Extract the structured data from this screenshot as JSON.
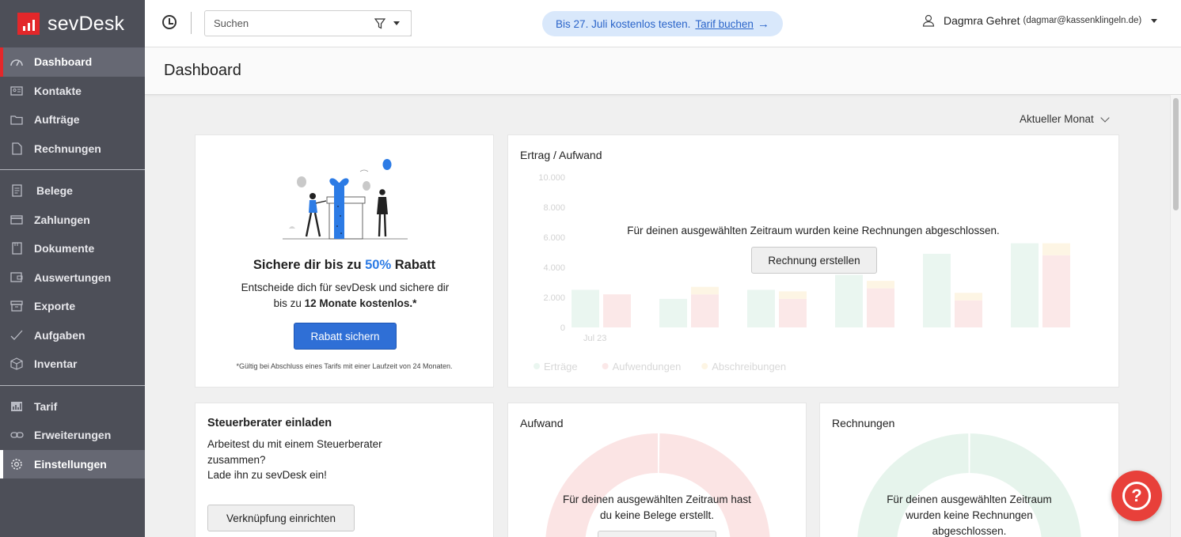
{
  "app": {
    "brand": "sevDesk"
  },
  "sidebar": {
    "items": [
      {
        "label": "Dashboard",
        "icon": "dashboard-icon"
      },
      {
        "label": "Kontakte",
        "icon": "contacts-icon"
      },
      {
        "label": "Aufträge",
        "icon": "folder-icon"
      },
      {
        "label": "Rechnungen",
        "icon": "document-icon"
      },
      {
        "label": "Belege",
        "icon": "receipt-icon"
      },
      {
        "label": "Zahlungen",
        "icon": "card-icon"
      },
      {
        "label": "Dokumente",
        "icon": "file-icon"
      },
      {
        "label": "Auswertungen",
        "icon": "wallet-icon"
      },
      {
        "label": "Exporte",
        "icon": "export-icon"
      },
      {
        "label": "Aufgaben",
        "icon": "check-icon"
      },
      {
        "label": "Inventar",
        "icon": "box-icon"
      },
      {
        "label": "Tarif",
        "icon": "bar-chart-icon"
      },
      {
        "label": "Erweiterungen",
        "icon": "link-icon"
      },
      {
        "label": "Einstellungen",
        "icon": "gear-icon"
      }
    ]
  },
  "topbar": {
    "search_placeholder": "Suchen",
    "trial_text": "Bis 27. Juli kostenlos testen.",
    "trial_link": "Tarif buchen",
    "user_name": "Dagmra Gehret",
    "user_email": "(dagmar@kassenklingeln.de)"
  },
  "header": {
    "title": "Dashboard"
  },
  "period": {
    "label": "Aktueller Monat"
  },
  "promo": {
    "title_prefix": "Sichere dir bis zu ",
    "title_accent": "50%",
    "title_suffix": " Rabatt",
    "text_line1": "Entscheide dich für sevDesk und sichere dir",
    "text_line2_prefix": "bis zu ",
    "text_line2_bold": "12 Monate kostenlos.*",
    "button": "Rabatt sichern",
    "footnote": "*Gültig bei Abschluss eines Tarifs mit einer Laufzeit von 24 Monaten."
  },
  "chart_card": {
    "title": "Ertrag / Aufwand",
    "empty_text": "Für deinen ausgewählten Zeitraum wurden keine Rechnungen abgeschlossen.",
    "button": "Rechnung erstellen"
  },
  "chart_data": {
    "type": "bar",
    "categories": [
      "Jul 23",
      "",
      "",
      "",
      "",
      ""
    ],
    "y_ticks": [
      "10.000",
      "8.000",
      "6.000",
      "4.000",
      "2.000",
      "0"
    ],
    "ylim": [
      0,
      10000
    ],
    "series": [
      {
        "name": "Erträge",
        "values": [
          2500,
          1900,
          2500,
          3500,
          4900,
          5600
        ]
      },
      {
        "name": "Aufwendungen",
        "values": [
          2200,
          2200,
          1900,
          2600,
          1800,
          4800
        ]
      },
      {
        "name": "Abschreibungen",
        "values": [
          0,
          500,
          500,
          500,
          500,
          800
        ]
      }
    ],
    "colors": {
      "Erträge": "#c9e9d8",
      "Aufwendungen": "#f7c3c5",
      "Abschreibungen": "#fbe7b9"
    },
    "legend_position": "bottom-left",
    "placeholder": true
  },
  "tax_card": {
    "title": "Steuerberater einladen",
    "line1": "Arbeitest du mit einem Steuerberater",
    "line2": "zusammen?",
    "line3": "Lade ihn zu sevDesk ein!",
    "button": "Verknüpfung einrichten"
  },
  "expense_card": {
    "title": "Aufwand",
    "line1": "Für deinen ausgewählten Zeitraum hast",
    "line2": "du keine Belege erstellt."
  },
  "invoice_card": {
    "title": "Rechnungen",
    "line1": "Für deinen ausgewählten Zeitraum",
    "line2": "wurden keine Rechnungen",
    "line3": "abgeschlossen."
  },
  "colors": {
    "accent": "#2c7be5",
    "brand_red": "#e3272a",
    "help": "#e8403a"
  }
}
